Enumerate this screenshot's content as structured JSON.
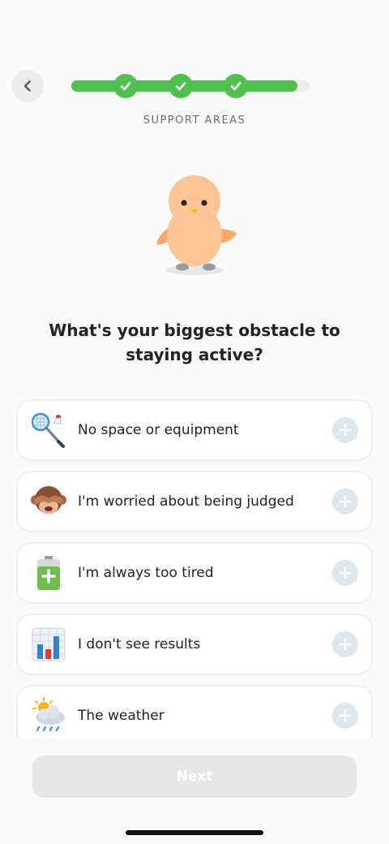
{
  "header": {
    "back_icon": "chevron-left-icon",
    "progress_fraction": 0.95,
    "completed_steps": 3,
    "step_label": "SUPPORT AREAS",
    "accent_color": "#4fbf4f"
  },
  "mascot": {
    "icon": "chick-mascot"
  },
  "question": "What's your biggest obstacle to staying active?",
  "options": [
    {
      "label": "No space or equipment",
      "icon": "badminton-icon"
    },
    {
      "label": "I'm worried about being judged",
      "icon": "see-no-evil-monkey-icon"
    },
    {
      "label": "I'm always too tired",
      "icon": "battery-icon"
    },
    {
      "label": "I don't see results",
      "icon": "bar-chart-icon"
    },
    {
      "label": "The weather",
      "icon": "weather-icon"
    }
  ],
  "next_button": {
    "label": "Next",
    "enabled": false
  }
}
